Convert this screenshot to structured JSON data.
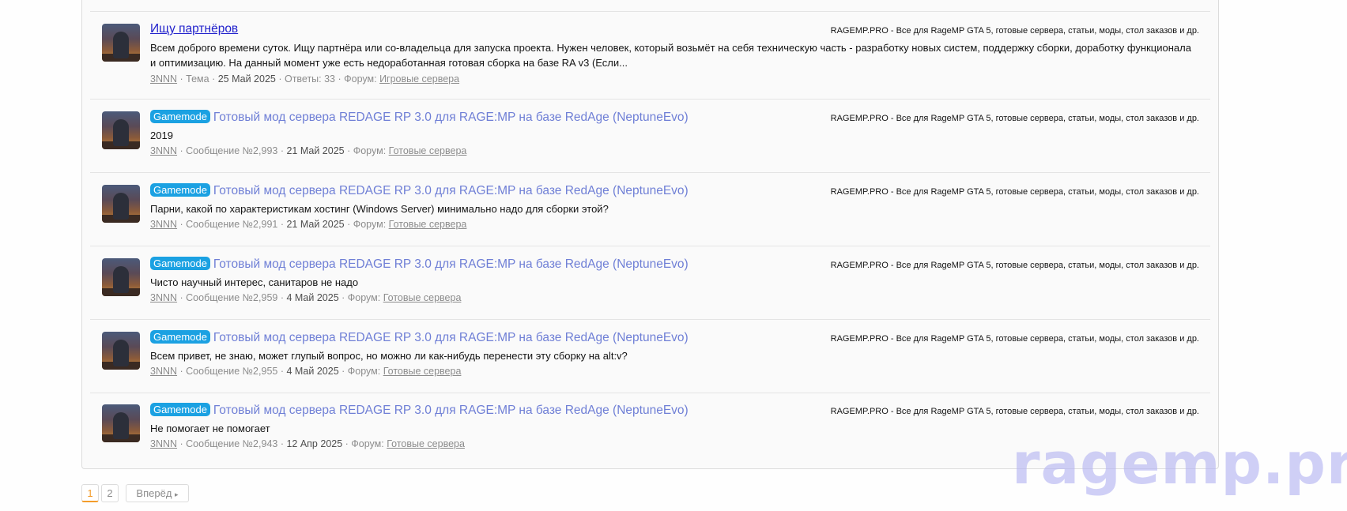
{
  "forum_description": "RAGEMP.PRO - Все для RageMP GTA 5, готовые сервера, статьи, моды, стол заказов и др.",
  "results": [
    {
      "title": "Ищу партнёров",
      "prefix": "",
      "snippet": "Всем доброго времени суток. Ищу партнёра или со-владельца для запуска проекта. Нужен человек, который возьмёт на себя техническую часть - разработку новых систем, поддержку сборки, доработку функционала и оптимизацию. На данный момент уже есть недоработанная готовая сборка на базе RA v3 (Если...",
      "author": "3NNN",
      "kind": "Тема",
      "date": "25 Май 2025",
      "replies": "Ответы: 33",
      "forum_label": "Форум:",
      "forum": "Игровые сервера"
    },
    {
      "title": "Готовый мод сервера REDAGE RP 3.0 для RAGE:MP на базе RedAge (NeptuneEvo)",
      "prefix": "Gamemode",
      "snippet": "2019",
      "author": "3NNN",
      "kind": "Сообщение №2,993",
      "date": "21 Май 2025",
      "forum_label": "Форум:",
      "forum": "Готовые сервера"
    },
    {
      "title": "Готовый мод сервера REDAGE RP 3.0 для RAGE:MP на базе RedAge (NeptuneEvo)",
      "prefix": "Gamemode",
      "snippet": "Парни, какой по характеристикам хостинг (Windows Server) минимально надо для сборки этой?",
      "author": "3NNN",
      "kind": "Сообщение №2,991",
      "date": "21 Май 2025",
      "forum_label": "Форум:",
      "forum": "Готовые сервера"
    },
    {
      "title": "Готовый мод сервера REDAGE RP 3.0 для RAGE:MP на базе RedAge (NeptuneEvo)",
      "prefix": "Gamemode",
      "snippet": "Чисто научный интерес, санитаров не надо",
      "author": "3NNN",
      "kind": "Сообщение №2,959",
      "date": "4 Май 2025",
      "forum_label": "Форум:",
      "forum": "Готовые сервера"
    },
    {
      "title": "Готовый мод сервера REDAGE RP 3.0 для RAGE:MP на базе RedAge (NeptuneEvo)",
      "prefix": "Gamemode",
      "snippet": "Всем привет, не знаю, может глупый вопрос, но можно ли как-нибудь перенести эту сборку на alt:v?",
      "author": "3NNN",
      "kind": "Сообщение №2,955",
      "date": "4 Май 2025",
      "forum_label": "Форум:",
      "forum": "Готовые сервера"
    },
    {
      "title": "Готовый мод сервера REDAGE RP 3.0 для RAGE:MP на базе RedAge (NeptuneEvo)",
      "prefix": "Gamemode",
      "snippet": "Не помогает не помогает",
      "author": "3NNN",
      "kind": "Сообщение №2,943",
      "date": "12 Апр 2025",
      "forum_label": "Форум:",
      "forum": "Готовые сервера"
    }
  ],
  "pagination": {
    "pages": [
      "1",
      "2"
    ],
    "current": "1",
    "next_label": "Вперёд"
  },
  "watermark": "ragemp.pro",
  "colors": {
    "badge": "#1ba1e2",
    "link": "#2222cc",
    "title_muted": "#6f7fd6",
    "pager_active": "#f39c2a",
    "watermark": "#b7b7f2"
  }
}
